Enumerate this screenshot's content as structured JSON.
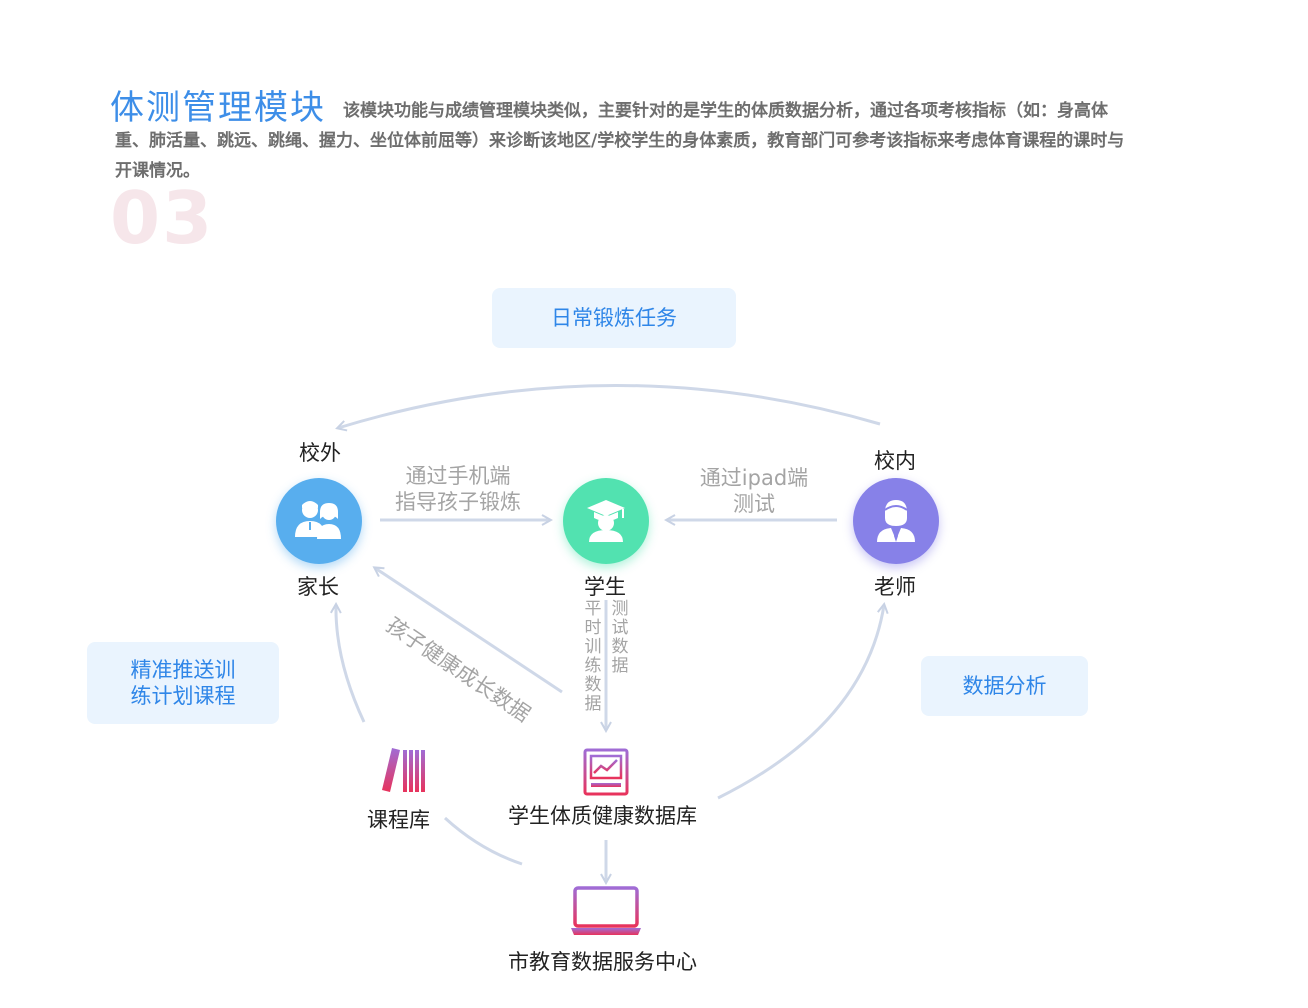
{
  "header": {
    "title": "体测管理模块",
    "description": "该模块功能与成绩管理模块类似，主要针对的是学生的体质数据分析，通过各项考核指标（如：身高体重、肺活量、跳远、跳绳、握力、坐位体前屈等）来诊断该地区/学校学生的身体素质，教育部门可参考该指标来考虑体育课程的课时与开课情况。",
    "index_number": "03"
  },
  "diagram": {
    "daily_task": "日常锻炼任务",
    "push_plan_line1": "精准推送训",
    "push_plan_line2": "练计划课程",
    "data_analysis": "数据分析",
    "offcampus": "校外",
    "oncampus": "校内",
    "parent": "家长",
    "student": "学生",
    "teacher": "老师",
    "via_phone_line1": "通过手机端",
    "via_phone_line2": "指导孩子锻炼",
    "via_ipad_line1": "通过ipad端",
    "via_ipad_line2": "测试",
    "child_growth_data": "孩子健康成长数据",
    "daily_training_data": "平时训练数据",
    "test_data": "测试数据",
    "course_library": "课程库",
    "health_database": "学生体质健康数据库",
    "city_center": "市教育数据服务中心"
  },
  "icons": {
    "parent": "parents-icon",
    "student": "graduate-icon",
    "teacher": "teacher-icon",
    "course_library": "books-icon",
    "health_database": "chart-report-icon",
    "city_center": "laptop-icon"
  },
  "colors": {
    "title": "#3d8ee8",
    "parent": "#58aeee",
    "student": "#52e2b0",
    "teacher": "#8781e8",
    "connector": "#cfd8e8",
    "pill_bg": "#eaf4fe",
    "pill_text": "#2f86e8"
  }
}
